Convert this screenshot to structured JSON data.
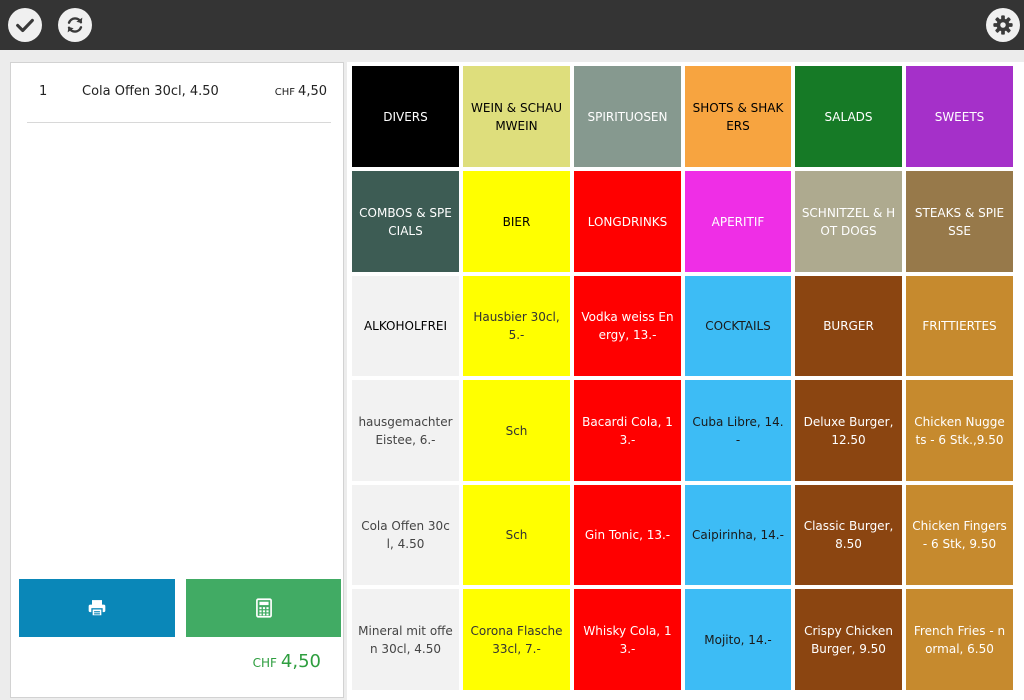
{
  "toolbar": {
    "confirm_icon": "checkmark-icon",
    "refresh_icon": "refresh-icon",
    "settings_icon": "gear-icon"
  },
  "order": {
    "lines": [
      {
        "qty": "1",
        "name": "Cola Offen 30cl, 4.50",
        "currency": "CHF",
        "price": "4,50"
      }
    ],
    "print_icon": "printer-icon",
    "calc_icon": "calculator-icon",
    "total_currency": "CHF",
    "total_value": "4,50"
  },
  "tiles": [
    [
      {
        "label": "DIVERS",
        "bg": "#000000",
        "fg": "#ffffff"
      },
      {
        "label": "WEIN & SCHAUMWEIN",
        "bg": "#dede7c",
        "fg": "#000000"
      },
      {
        "label": "SPIRITUOSEN",
        "bg": "#86998f",
        "fg": "#ffffff"
      },
      {
        "label": "SHOTS & SHAKERS",
        "bg": "#f7a440",
        "fg": "#000000"
      },
      {
        "label": "SALADS",
        "bg": "#167a26",
        "fg": "#ffffff"
      },
      {
        "label": "SWEETS",
        "bg": "#a530c9",
        "fg": "#ffffff"
      }
    ],
    [
      {
        "label": "COMBOS & SPECIALS",
        "bg": "#3d5c54",
        "fg": "#ffffff"
      },
      {
        "label": "BIER",
        "bg": "#ffff00",
        "fg": "#000000"
      },
      {
        "label": "LONGDRINKS",
        "bg": "#ff0000",
        "fg": "#ffffff"
      },
      {
        "label": "APERITIF",
        "bg": "#ef2ee6",
        "fg": "#ffffff"
      },
      {
        "label": "SCHNITZEL & HOT DOGS",
        "bg": "#aeaa8f",
        "fg": "#ffffff"
      },
      {
        "label": "STEAKS & SPIESSE",
        "bg": "#97794a",
        "fg": "#ffffff"
      }
    ],
    [
      {
        "label": "ALKOHOLFREI",
        "bg": "#f2f2f2",
        "fg": "#000000"
      },
      {
        "label": "Hausbier 30cl, 5.-",
        "bg": "#ffff00",
        "fg": "#333333"
      },
      {
        "label": "Vodka weiss Energy, 13.-",
        "bg": "#ff0000",
        "fg": "#ffffff"
      },
      {
        "label": "COCKTAILS",
        "bg": "#3dbcf5",
        "fg": "#1a1a1a"
      },
      {
        "label": "BURGER",
        "bg": "#8b4511",
        "fg": "#ffffff"
      },
      {
        "label": "FRITTIERTES",
        "bg": "#c68a2e",
        "fg": "#ffffff"
      }
    ],
    [
      {
        "label": "hausgemachter Eistee, 6.-",
        "bg": "#f2f2f2",
        "fg": "#444444"
      },
      {
        "label": "Sch",
        "bg": "#ffff00",
        "fg": "#333333"
      },
      {
        "label": "Bacardi Cola, 13.-",
        "bg": "#ff0000",
        "fg": "#ffffff"
      },
      {
        "label": "Cuba Libre, 14.-",
        "bg": "#3dbcf5",
        "fg": "#1a1a1a"
      },
      {
        "label": "Deluxe Burger, 12.50",
        "bg": "#8b4511",
        "fg": "#ffffff"
      },
      {
        "label": "Chicken Nuggets - 6 Stk.,9.50",
        "bg": "#c68a2e",
        "fg": "#ffffff"
      }
    ],
    [
      {
        "label": "Cola Offen 30cl, 4.50",
        "bg": "#f2f2f2",
        "fg": "#444444"
      },
      {
        "label": "Sch",
        "bg": "#ffff00",
        "fg": "#333333"
      },
      {
        "label": "Gin Tonic, 13.-",
        "bg": "#ff0000",
        "fg": "#ffffff"
      },
      {
        "label": "Caipirinha, 14.-",
        "bg": "#3dbcf5",
        "fg": "#1a1a1a"
      },
      {
        "label": "Classic Burger, 8.50",
        "bg": "#8b4511",
        "fg": "#ffffff"
      },
      {
        "label": "Chicken Fingers - 6 Stk, 9.50",
        "bg": "#c68a2e",
        "fg": "#ffffff"
      }
    ],
    [
      {
        "label": "Mineral mit offen 30cl, 4.50",
        "bg": "#f2f2f2",
        "fg": "#444444"
      },
      {
        "label": "Corona Flasche 33cl, 7.-",
        "bg": "#ffff00",
        "fg": "#333333"
      },
      {
        "label": "Whisky Cola, 13.-",
        "bg": "#ff0000",
        "fg": "#ffffff"
      },
      {
        "label": "Mojito, 14.-",
        "bg": "#3dbcf5",
        "fg": "#1a1a1a"
      },
      {
        "label": "Crispy Chicken Burger, 9.50",
        "bg": "#8b4511",
        "fg": "#ffffff"
      },
      {
        "label": "French Fries - normal, 6.50",
        "bg": "#c68a2e",
        "fg": "#ffffff"
      }
    ]
  ]
}
